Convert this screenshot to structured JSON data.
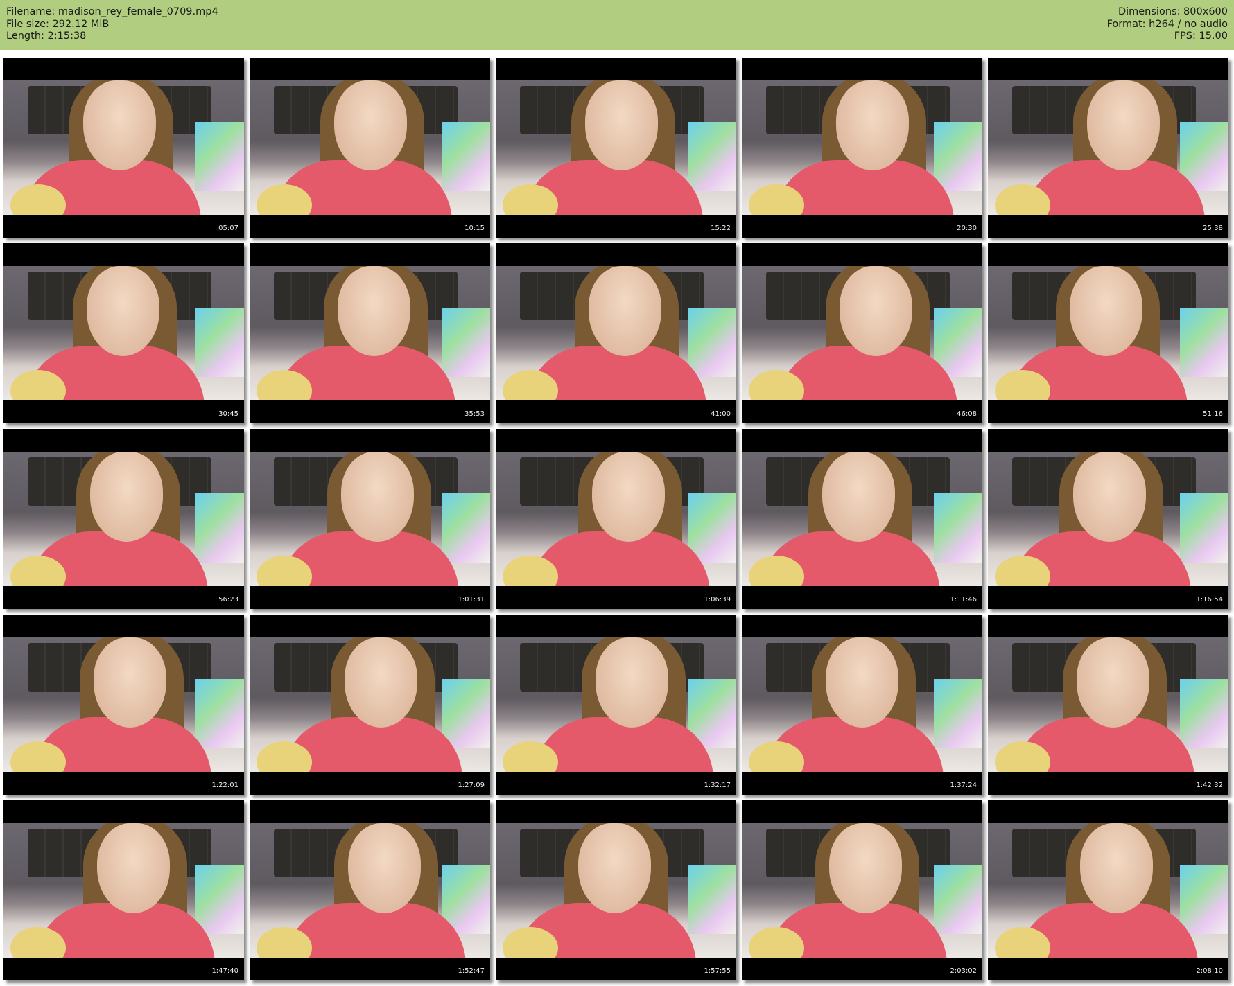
{
  "info_left": {
    "filename": "Filename: madison_rey_female_0709.mp4",
    "file_size": "File size: 292.12 MiB",
    "length": "Length: 2:15:38"
  },
  "info_right": {
    "dimensions": "Dimensions: 800x600",
    "format": "Format: h264 / no audio",
    "fps": "FPS: 15.00"
  },
  "thumbnails": [
    "05:07",
    "10:15",
    "15:22",
    "20:30",
    "25:38",
    "30:45",
    "35:53",
    "41:00",
    "46:08",
    "51:16",
    "56:23",
    "1:01:31",
    "1:06:39",
    "1:11:46",
    "1:16:54",
    "1:22:01",
    "1:27:09",
    "1:32:17",
    "1:37:24",
    "1:42:32",
    "1:47:40",
    "1:52:47",
    "1:57:55",
    "2:03:02",
    "2:08:10"
  ],
  "colors": {
    "header_bg": "#b1cd80"
  }
}
